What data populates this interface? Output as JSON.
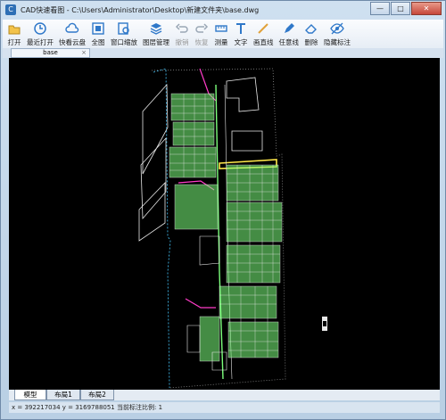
{
  "window": {
    "title": "CAD快速看图 - C:\\Users\\Administrator\\Desktop\\新建文件夹\\base.dwg",
    "minimize": "—",
    "maximize": "□",
    "close": "✕"
  },
  "toolbar": [
    {
      "id": "open",
      "label": "打开",
      "icon": "folder-icon",
      "enabled": true
    },
    {
      "id": "recent",
      "label": "最近打开",
      "icon": "history-icon",
      "enabled": true
    },
    {
      "id": "cloud",
      "label": "快看云盘",
      "icon": "cloud-icon",
      "enabled": true
    },
    {
      "id": "fullview",
      "label": "全图",
      "icon": "fit-view-icon",
      "enabled": true
    },
    {
      "id": "window-zoom",
      "label": "窗口缩放",
      "icon": "zoom-window-icon",
      "enabled": true
    },
    {
      "id": "layers",
      "label": "图层管理",
      "icon": "layers-icon",
      "enabled": true
    },
    {
      "id": "undo",
      "label": "撤销",
      "icon": "undo-icon",
      "enabled": false
    },
    {
      "id": "redo",
      "label": "恢复",
      "icon": "redo-icon",
      "enabled": false
    },
    {
      "id": "measure",
      "label": "测量",
      "icon": "measure-icon",
      "enabled": true
    },
    {
      "id": "text",
      "label": "文字",
      "icon": "text-icon",
      "enabled": true
    },
    {
      "id": "line",
      "label": "画直线",
      "icon": "line-icon",
      "enabled": true
    },
    {
      "id": "freehand",
      "label": "任意线",
      "icon": "pen-icon",
      "enabled": true
    },
    {
      "id": "erase",
      "label": "删除",
      "icon": "eraser-icon",
      "enabled": true
    },
    {
      "id": "hide-marks",
      "label": "隐藏标注",
      "icon": "eye-icon",
      "enabled": true
    }
  ],
  "document_tab": {
    "label": "base",
    "close": "×"
  },
  "layout_tabs": [
    {
      "label": "模型",
      "active": true
    },
    {
      "label": "布局1",
      "active": false
    },
    {
      "label": "布局2",
      "active": false
    }
  ],
  "status": "x = 392217034  y = 3169788051  当前标注比例: 1",
  "colors": {
    "canvas": "#000000",
    "cad_green": "#7CFF7C",
    "cad_white": "#E8E8E8",
    "cad_magenta": "#FF3CC8",
    "cad_yellow": "#FFE84A",
    "cad_cyan": "#46C8FF"
  }
}
